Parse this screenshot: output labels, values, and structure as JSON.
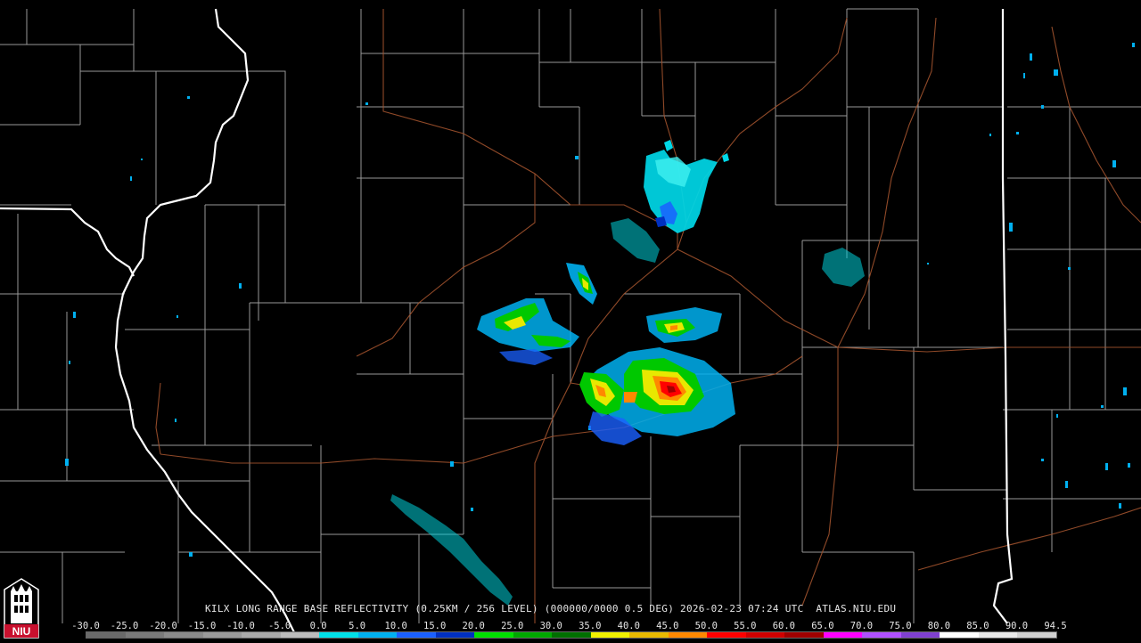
{
  "product_caption": "KILX LONG RANGE BASE REFLECTIVITY (0.25KM / 256 LEVEL) (000000/0000 0.5 DEG) 2026-02-23 07:24 UTC  ATLAS.NIU.EDU",
  "logo": {
    "text": "NIU",
    "icon": "niu-tower-icon"
  },
  "legend": {
    "labels": [
      "-30.0",
      "-25.0",
      "-20.0",
      "-15.0",
      "-10.0",
      "-5.0",
      "0.0",
      "5.0",
      "10.0",
      "15.0",
      "20.0",
      "25.0",
      "30.0",
      "35.0",
      "40.0",
      "45.0",
      "50.0",
      "55.0",
      "60.0",
      "65.0",
      "70.0",
      "75.0",
      "80.0",
      "85.0",
      "90.0",
      "94.5"
    ],
    "colors": [
      "#6a6a6a",
      "#7a7a7a",
      "#8a8a8a",
      "#9a9a9a",
      "#aaaaaa",
      "#bcbcbc",
      "#00e0e8",
      "#00b0f0",
      "#1a60ff",
      "#0030c0",
      "#00e000",
      "#00a800",
      "#007000",
      "#f0f000",
      "#e8b800",
      "#ff8800",
      "#ff0000",
      "#d00000",
      "#a00000",
      "#ff00ff",
      "#b050ff",
      "#8040d0",
      "#ffffff",
      "#e8e8e8",
      "#d0d0d0"
    ]
  },
  "colors": {
    "background": "#000000",
    "state_border": "#ffffff",
    "county_border": "#b4b4b4",
    "highway": "#a0522d"
  }
}
